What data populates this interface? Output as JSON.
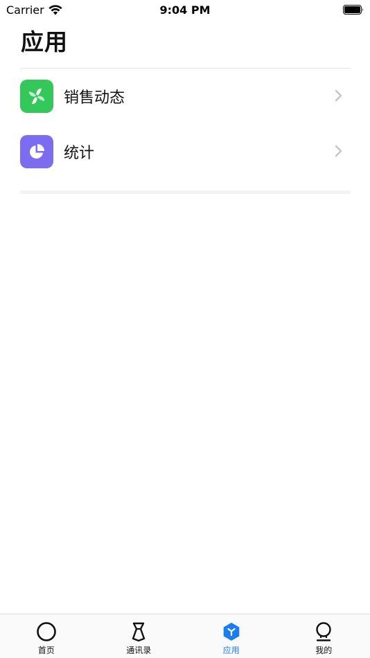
{
  "status_bar": {
    "carrier": "Carrier",
    "time": "9:04 PM"
  },
  "page": {
    "title": "应用"
  },
  "apps": [
    {
      "label": "销售动态",
      "icon": "pinwheel-icon",
      "color": "#34c759"
    },
    {
      "label": "统计",
      "icon": "pie-chart-icon",
      "color": "#7b6cf0"
    }
  ],
  "tab_bar": {
    "active_color": "#1a7df0",
    "tabs": [
      {
        "label": "首页",
        "icon": "circle-home-icon",
        "active": false
      },
      {
        "label": "通讯录",
        "icon": "contacts-tie-icon",
        "active": false
      },
      {
        "label": "应用",
        "icon": "hexagon-apps-icon",
        "active": true
      },
      {
        "label": "我的",
        "icon": "profile-person-icon",
        "active": false
      }
    ]
  }
}
